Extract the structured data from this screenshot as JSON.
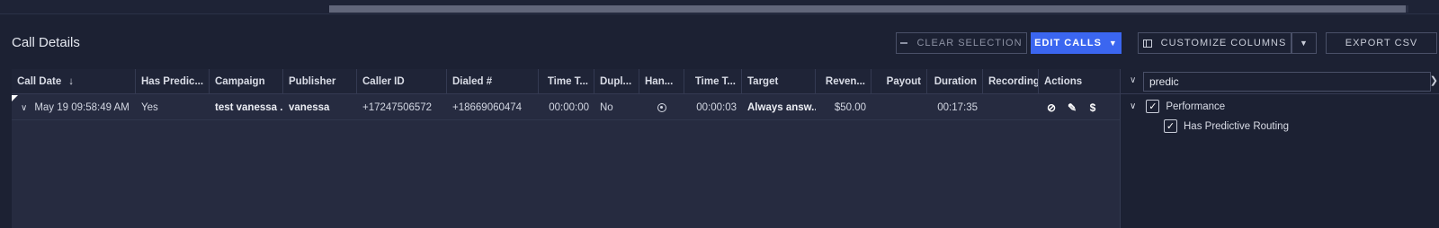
{
  "section_title": "Call Details",
  "toolbar": {
    "clear_selection": "CLEAR SELECTION",
    "edit_calls": "EDIT CALLS",
    "customize_columns": "CUSTOMIZE COLUMNS",
    "export_csv": "EXPORT CSV"
  },
  "columns": [
    "Call Date",
    "Has Predic...",
    "Campaign",
    "Publisher",
    "Caller ID",
    "Dialed #",
    "Time T...",
    "Dupl...",
    "Han...",
    "Time T...",
    "Target",
    "Reven...",
    "Payout",
    "Duration",
    "Recording",
    "Actions"
  ],
  "row": {
    "call_date": "May 19 09:58:49 AM",
    "has_predictive": "Yes",
    "campaign": "test vanessa ...",
    "publisher": "vanessa",
    "caller_id": "+17247506572",
    "dialed": "+18669060474",
    "time_to_answer": "00:00:00",
    "duplicate": "No",
    "time_to_connect": "00:00:03",
    "target": "Always answ...",
    "revenue": "$50.00",
    "payout": "",
    "duration": "00:17:35",
    "recording": ""
  },
  "column_panel": {
    "search_value": "predic",
    "group_label": "Performance",
    "item_label": "Has Predictive Routing",
    "group_checked": true,
    "item_checked": true
  },
  "icons": {
    "sort": "arrow-down-icon",
    "expand_row": "chevron-down-icon",
    "handled": "target-icon",
    "block": "block-icon",
    "edit": "pencil-icon",
    "dollar": "dollar-icon"
  },
  "colors": {
    "background": "#1c2133",
    "grid": "#262b40",
    "accent": "#3b66f0"
  }
}
